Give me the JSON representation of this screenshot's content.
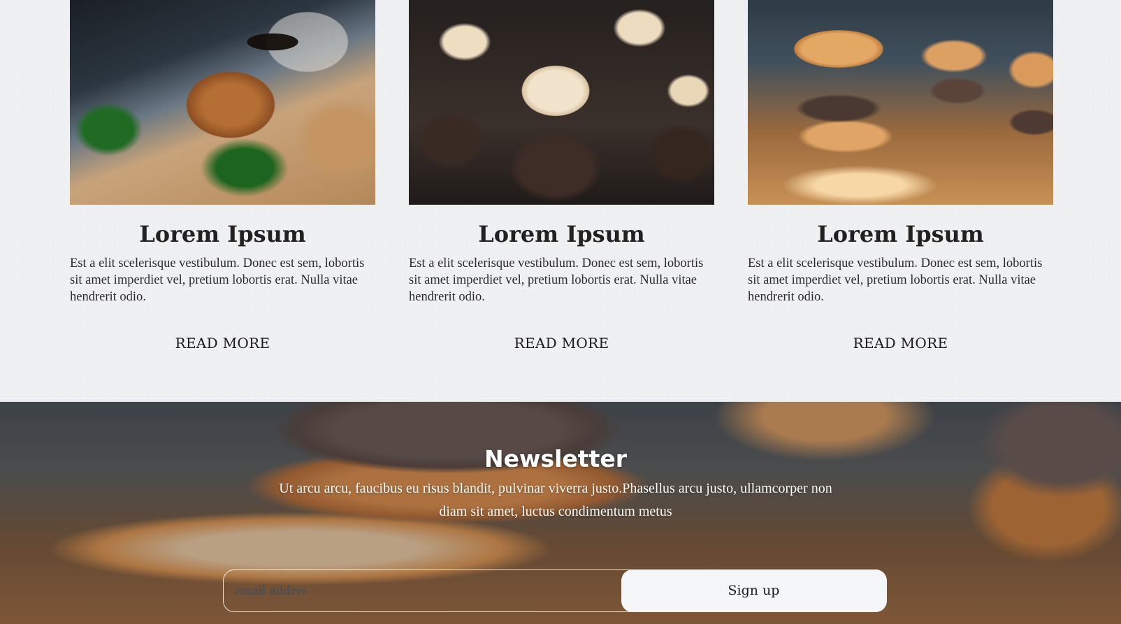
{
  "cards": [
    {
      "image": "sandwich-and-coffee-photo",
      "title": "Lorem Ipsum",
      "text": "Est a elit scelerisque vestibulum. Donec est sem, lobortis sit amet imperdiet vel, pretium lobortis erat. Nulla vitae hendrerit odio.",
      "link": "READ MORE"
    },
    {
      "image": "cupcakes-photo",
      "title": "Lorem Ipsum",
      "text": "Est a elit scelerisque vestibulum. Donec est sem, lobortis sit amet imperdiet vel, pretium lobortis erat. Nulla vitae hendrerit odio.",
      "link": "READ MORE"
    },
    {
      "image": "burgers-photo",
      "title": "Lorem Ipsum",
      "text": "Est a elit scelerisque vestibulum. Donec est sem, lobortis sit amet imperdiet vel, pretium lobortis erat. Nulla vitae hendrerit odio.",
      "link": "READ MORE"
    }
  ],
  "newsletter": {
    "title": "Newsletter",
    "text": "Ut arcu arcu, faucibus eu risus blandit, pulvinar viverra justo.Phasellus arcu justo, ullamcorper non diam sit amet, luctus condimentum metus",
    "email_placeholder": "email addres",
    "button_label": "Sign up"
  },
  "colors": {
    "page_background": "#eff0f2",
    "heading_text": "#232020",
    "button_background": "#f5f6f8"
  }
}
